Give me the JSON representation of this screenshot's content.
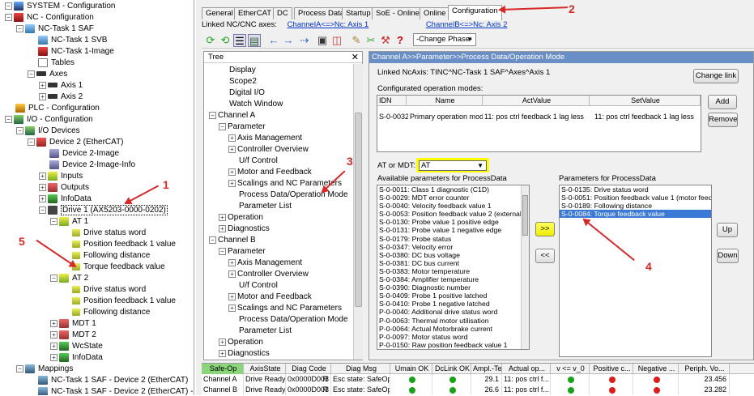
{
  "solution_tree": [
    {
      "indent": 0,
      "exp": "-",
      "icon": "i-sys",
      "label": "SYSTEM - Configuration"
    },
    {
      "indent": 0,
      "exp": "-",
      "icon": "i-nc",
      "label": "NC - Configuration"
    },
    {
      "indent": 1,
      "exp": "-",
      "icon": "i-task",
      "label": "NC-Task 1 SAF"
    },
    {
      "indent": 2,
      "exp": "",
      "icon": "i-task",
      "label": "NC-Task 1 SVB"
    },
    {
      "indent": 2,
      "exp": "",
      "icon": "i-nc",
      "label": "NC-Task 1-Image"
    },
    {
      "indent": 2,
      "exp": "",
      "icon": "i-tbl",
      "label": "Tables"
    },
    {
      "indent": 2,
      "exp": "-",
      "icon": "i-axes",
      "label": "Axes"
    },
    {
      "indent": 3,
      "exp": "+",
      "icon": "i-axes",
      "label": "Axis 1"
    },
    {
      "indent": 3,
      "exp": "+",
      "icon": "i-axes",
      "label": "Axis 2"
    },
    {
      "indent": 0,
      "exp": "",
      "icon": "i-plc",
      "label": "PLC - Configuration"
    },
    {
      "indent": 0,
      "exp": "-",
      "icon": "i-io",
      "label": "I/O - Configuration"
    },
    {
      "indent": 1,
      "exp": "-",
      "icon": "i-io",
      "label": "I/O Devices"
    },
    {
      "indent": 2,
      "exp": "-",
      "icon": "i-dev",
      "label": "Device 2 (EtherCAT)"
    },
    {
      "indent": 3,
      "exp": "",
      "icon": "i-img",
      "label": "Device 2-Image"
    },
    {
      "indent": 3,
      "exp": "",
      "icon": "i-img",
      "label": "Device 2-Image-Info"
    },
    {
      "indent": 3,
      "exp": "+",
      "icon": "i-in",
      "label": "Inputs"
    },
    {
      "indent": 3,
      "exp": "+",
      "icon": "i-out",
      "label": "Outputs"
    },
    {
      "indent": 3,
      "exp": "+",
      "icon": "i-data",
      "label": "InfoData"
    },
    {
      "indent": 3,
      "exp": "-",
      "icon": "i-drive",
      "label": "Drive 1 (AX5203-0000-0202)",
      "boxed": true
    },
    {
      "indent": 4,
      "exp": "-",
      "icon": "i-in",
      "label": "AT 1"
    },
    {
      "indent": 5,
      "exp": "",
      "icon": "i-var",
      "label": "Drive status word"
    },
    {
      "indent": 5,
      "exp": "",
      "icon": "i-var",
      "label": "Position feedback 1 value"
    },
    {
      "indent": 5,
      "exp": "",
      "icon": "i-var",
      "label": "Following distance"
    },
    {
      "indent": 5,
      "exp": "",
      "icon": "i-var",
      "label": "Torque feedback value"
    },
    {
      "indent": 4,
      "exp": "-",
      "icon": "i-in",
      "label": "AT 2"
    },
    {
      "indent": 5,
      "exp": "",
      "icon": "i-var",
      "label": "Drive status word"
    },
    {
      "indent": 5,
      "exp": "",
      "icon": "i-var",
      "label": "Position feedback 1 value"
    },
    {
      "indent": 5,
      "exp": "",
      "icon": "i-var",
      "label": "Following distance"
    },
    {
      "indent": 4,
      "exp": "+",
      "icon": "i-out",
      "label": "MDT 1"
    },
    {
      "indent": 4,
      "exp": "+",
      "icon": "i-out",
      "label": "MDT 2"
    },
    {
      "indent": 4,
      "exp": "+",
      "icon": "i-data",
      "label": "WcState"
    },
    {
      "indent": 4,
      "exp": "+",
      "icon": "i-data",
      "label": "InfoData"
    },
    {
      "indent": 1,
      "exp": "-",
      "icon": "i-map",
      "label": "Mappings"
    },
    {
      "indent": 2,
      "exp": "",
      "icon": "i-map",
      "label": "NC-Task 1 SAF - Device 2 (EtherCAT)"
    },
    {
      "indent": 2,
      "exp": "",
      "icon": "i-map",
      "label": "NC-Task 1 SAF - Device 2 (EtherCAT) - Info"
    }
  ],
  "tabs": [
    "General",
    "EtherCAT",
    "DC",
    "Process Data",
    "Startup",
    "SoE - Online",
    "Online",
    "Configuration"
  ],
  "active_tab": "Configuration",
  "linked_nc_label": "Linked NC/CNC axes:",
  "channel_a_link": "ChannelA<=>Nc: Axis 1",
  "channel_b_link": "ChannelB<=>Nc: Axis 2",
  "change_phase": "-Change Phase-",
  "tree_panel_title": "Tree",
  "tree_items": [
    {
      "indent": 1,
      "exp": "",
      "label": "Display"
    },
    {
      "indent": 1,
      "exp": "",
      "label": "Scope2"
    },
    {
      "indent": 1,
      "exp": "",
      "label": "Digital I/O"
    },
    {
      "indent": 1,
      "exp": "",
      "label": "Watch Window"
    },
    {
      "indent": 0,
      "exp": "-",
      "label": "Channel A"
    },
    {
      "indent": 1,
      "exp": "-",
      "label": "Parameter"
    },
    {
      "indent": 2,
      "exp": "+",
      "label": "Axis Management"
    },
    {
      "indent": 2,
      "exp": "+",
      "label": "Controller Overview"
    },
    {
      "indent": 2,
      "exp": "",
      "label": "U/f Control"
    },
    {
      "indent": 2,
      "exp": "+",
      "label": "Motor and Feedback"
    },
    {
      "indent": 2,
      "exp": "+",
      "label": "Scalings and NC Parameters"
    },
    {
      "indent": 2,
      "exp": "",
      "label": "Process Data/Operation Mode"
    },
    {
      "indent": 2,
      "exp": "",
      "label": "Parameter List"
    },
    {
      "indent": 1,
      "exp": "+",
      "label": "Operation"
    },
    {
      "indent": 1,
      "exp": "+",
      "label": "Diagnostics"
    },
    {
      "indent": 0,
      "exp": "-",
      "label": "Channel B"
    },
    {
      "indent": 1,
      "exp": "-",
      "label": "Parameter"
    },
    {
      "indent": 2,
      "exp": "+",
      "label": "Axis Management"
    },
    {
      "indent": 2,
      "exp": "+",
      "label": "Controller Overview"
    },
    {
      "indent": 2,
      "exp": "",
      "label": "U/f Control"
    },
    {
      "indent": 2,
      "exp": "+",
      "label": "Motor and Feedback"
    },
    {
      "indent": 2,
      "exp": "+",
      "label": "Scalings and NC Parameters"
    },
    {
      "indent": 2,
      "exp": "",
      "label": "Process Data/Operation Mode"
    },
    {
      "indent": 2,
      "exp": "",
      "label": "Parameter List"
    },
    {
      "indent": 1,
      "exp": "+",
      "label": "Operation"
    },
    {
      "indent": 1,
      "exp": "+",
      "label": "Diagnostics"
    }
  ],
  "panel_title": "Channel A>>Parameter>>Process Data/Operation Mode",
  "linked_ncaxis": "Linked NcAxis: TINC^NC-Task 1 SAF^Axes^Axis 1",
  "change_link": "Change link",
  "configured_modes_label": "Configurated operation modes:",
  "modes_columns": [
    "IDN",
    "Name",
    "ActValue",
    "SetValue"
  ],
  "modes_rows": [
    [
      "S-0-0032",
      "Primary operation mode",
      "11: pos ctrl feedback 1 lag less",
      "11: pos ctrl feedback 1 lag less"
    ]
  ],
  "add_label": "Add",
  "remove_label": "Remove",
  "at_or_mdt_label": "AT or MDT:",
  "at_or_mdt_value": "AT",
  "available_label": "Available parameters for ProcessData",
  "available_params": [
    "S-0-0011: Class 1 diagnostic (C1D)",
    "S-0-0029: MDT error counter",
    "S-0-0040: Velocity feedback value 1",
    "S-0-0053: Position feedback value 2 (external f",
    "S-0-0130: Probe value 1 positive edge",
    "S-0-0131: Probe value 1 negative edge",
    "S-0-0179: Probe status",
    "S-0-0347: Velocity error",
    "S-0-0380: DC bus voltage",
    "S-0-0381: DC bus current",
    "S-0-0383: Motor temperature",
    "S-0-0384: Amplifier temperature",
    "S-0-0390: Diagnostic number",
    "S-0-0409: Probe 1 positive latched",
    "S-0-0410: Probe 1 negative latched",
    "P-0-0040: Additional drive status word",
    "P-0-0063: Thermal motor utilisation",
    "P-0-0064: Actual Motorbrake current",
    "P-0-0097: Motor status word",
    "P-0-0150: Raw position feedback value 1"
  ],
  "add_arrow": ">>",
  "remove_arrow": "<<",
  "processdata_label": "Parameters for ProcessData",
  "processdata_params": [
    "S-0-0135: Drive status word",
    "S-0-0051: Position feedback value 1 (motor feedba",
    "S-0-0189: Following distance",
    "S-0-0084: Torque feedback value"
  ],
  "processdata_selected": 3,
  "up_label": "Up",
  "down_label": "Down",
  "status_columns": [
    "Safe-Op",
    "AxisState",
    "Diag Code",
    "Diag Msg",
    "Umain OK",
    "DcLink OK",
    "Ampl.-Te...",
    "Actual op...",
    "v <= v_0",
    "Positive c...",
    "Negative ...",
    "Periph. Vo..."
  ],
  "status_rows": [
    {
      "ch": "Channel A",
      "axis": "Drive Ready",
      "code": "0x0000D003",
      "r": "R",
      "msg": "Esc state: SafeOp",
      "umain": "green",
      "dclink": "green",
      "ampl": "29.1",
      "actop": "11: pos ctrl f...",
      "v0": "green",
      "pos": "red",
      "neg": "red",
      "periph": "23.456"
    },
    {
      "ch": "Channel B",
      "axis": "Drive Ready",
      "code": "0x0000D003",
      "r": "R",
      "msg": "Esc state: SafeOp",
      "umain": "green",
      "dclink": "green",
      "ampl": "26.6",
      "actop": "11: pos ctrl f...",
      "v0": "green",
      "pos": "red",
      "neg": "red",
      "periph": "23.282"
    }
  ],
  "annotations": [
    "1",
    "2",
    "3",
    "4",
    "5"
  ],
  "colors": {
    "accent": "#6a8ec6",
    "annotation": "#d42a2a",
    "highlight": "#ffff00",
    "selection": "#3a79d6"
  }
}
